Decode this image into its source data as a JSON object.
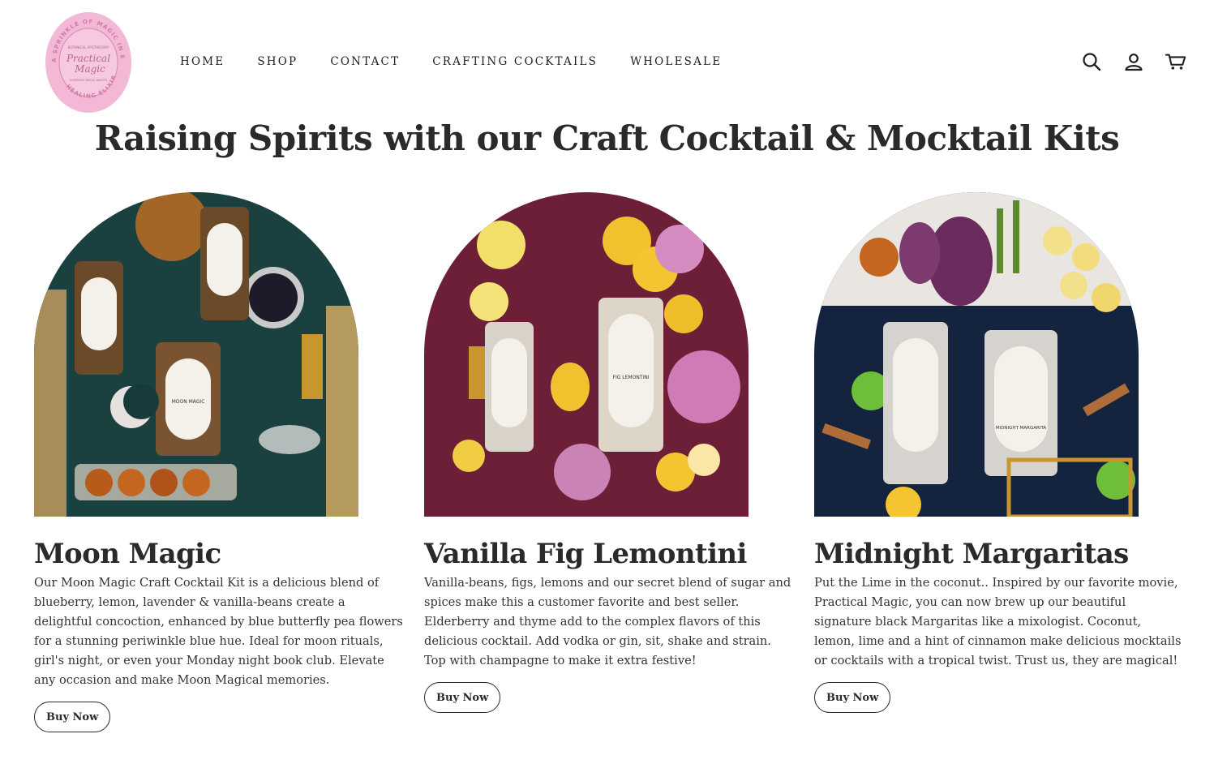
{
  "brand": {
    "logo_top_arc": "A SPRINKLE OF MAGIC IN EVERY",
    "logo_bottom_arc": "HEALING ELIXIR",
    "logo_subtitle": "BOTANICAL APOTHECARY",
    "logo_name_line1": "Practical",
    "logo_name_line2": "Magic",
    "logo_tagline": "EVERYDAY MAGIC AWAITS",
    "logo_color": "#f3b8d6"
  },
  "nav": {
    "items": [
      {
        "label": "HOME"
      },
      {
        "label": "SHOP"
      },
      {
        "label": "CONTACT"
      },
      {
        "label": "CRAFTING COCKTAILS"
      },
      {
        "label": "WHOLESALE"
      }
    ]
  },
  "header_icons": [
    "search-icon",
    "account-icon",
    "cart-icon"
  ],
  "page": {
    "title": "Raising Spirits with our Craft Cocktail & Mocktail Kits"
  },
  "products": [
    {
      "title": "Moon Magic",
      "description": "Our Moon Magic Craft Cocktail Kit is a delicious blend of blueberry, lemon, lavender & vanilla-beans create a delightful concoction, enhanced by blue butterfly pea flowers for a stunning periwinkle blue hue. Ideal for moon rituals, girl's night, or even your Monday night book club. Elevate any occasion and make Moon Magical memories.",
      "button": "Buy Now",
      "jar_label": "MOON MAGIC",
      "bg_color": "#163b3a"
    },
    {
      "title": "Vanilla Fig Lemontini",
      "description": "Vanilla-beans, figs, lemons and our secret blend of sugar and spices make this a customer favorite and best seller. Elderberry and thyme add to the complex flavors of this delicious cocktail. Add vodka or gin, sit, shake and strain. Top with champagne to make it extra festive!",
      "button": "Buy Now",
      "jar_label": "FIG LEMONTINI",
      "bg_color": "#6e1f38"
    },
    {
      "title": "Midnight Margaritas",
      "description": "Put the Lime in the coconut.. Inspired by our favorite movie, Practical Magic, you can now brew up our beautiful signature black Margaritas like a mixologist. Coconut, lemon, lime and a hint of cinnamon make delicious mocktails or cocktails with a tropical twist. Trust us, they are magical!",
      "button": "Buy Now",
      "jar_label": "MIDNIGHT MARGARITA",
      "bg_color": "#14243f"
    }
  ]
}
